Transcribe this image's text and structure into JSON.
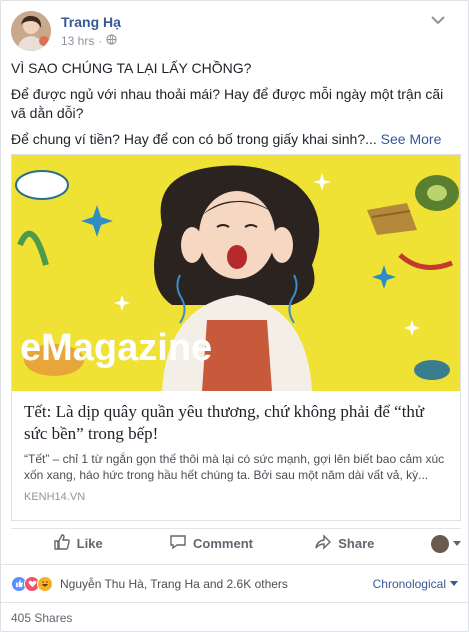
{
  "post": {
    "author": "Trang Hạ",
    "time": "13 hrs",
    "separator": "·",
    "privacy_icon": "globe-icon",
    "text": {
      "line1": "VÌ SAO CHÚNG TA LẠI LẤY CHỒNG?",
      "line2": "Để được ngủ với nhau thoải mái? Hay để được mỗi ngày một trận cãi vã dằn dỗi?",
      "line3": "Để chung ví tiền? Hay để con có bố trong giấy khai sinh?...",
      "see_more": "See More"
    }
  },
  "link": {
    "brand": "eMagazine",
    "title": "Tết: Là dịp quây quần yêu thương, chứ không phải để “thử sức bền” trong bếp!",
    "description": "“Tết” – chỉ 1 từ ngắn gọn thế thôi mà lại có sức mạnh, gợi lên biết bao cảm xúc xốn xang, háo hức trong hầu hết chúng ta. Bởi sau một năm dài vất vả, kỳ...",
    "domain": "KENH14.VN"
  },
  "actions": {
    "like": "Like",
    "comment": "Comment",
    "share": "Share"
  },
  "reactions": {
    "names": "Nguyễn Thu Hà, Trang Ha and 2.6K others",
    "sort": "Chronological",
    "colors": {
      "like": "#5890ff",
      "love": "#f25268",
      "haha": "#f7b125"
    }
  },
  "shares": "405 Shares"
}
